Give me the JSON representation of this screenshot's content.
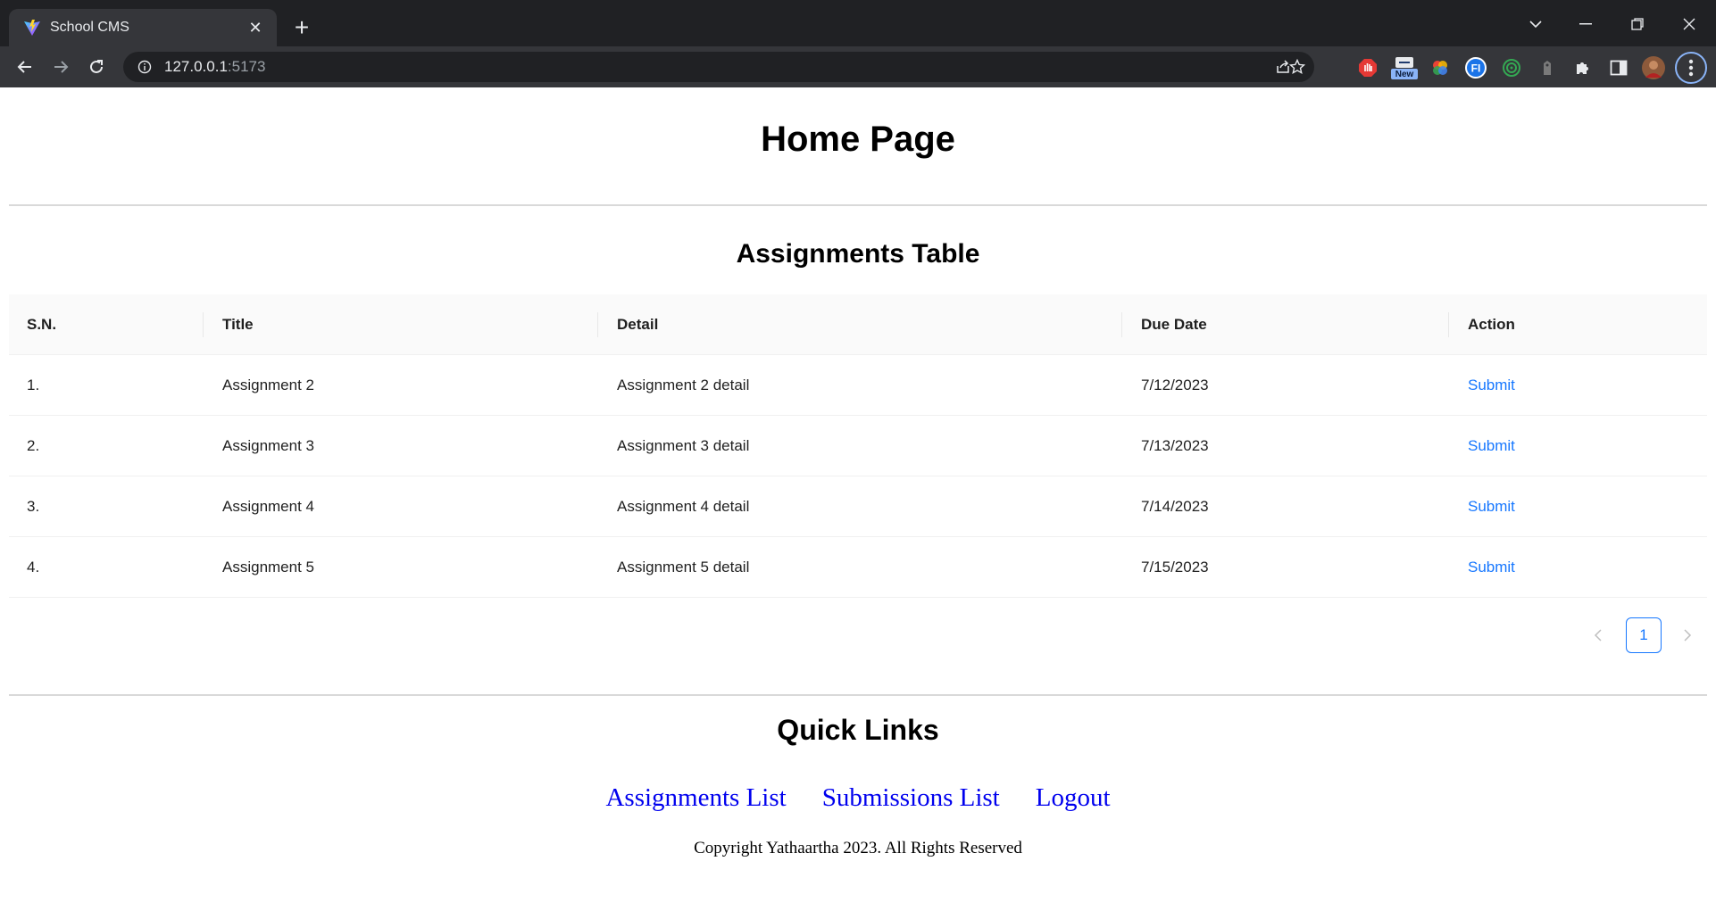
{
  "browser": {
    "tab_title": "School CMS",
    "url_host": "127.0.0.1",
    "url_port": ":5173",
    "extension_badge": "New"
  },
  "page": {
    "title": "Home Page",
    "assignments": {
      "heading": "Assignments Table",
      "columns": [
        "S.N.",
        "Title",
        "Detail",
        "Due Date",
        "Action"
      ],
      "rows": [
        {
          "sn": "1.",
          "title": "Assignment 2",
          "detail": "Assignment 2 detail",
          "due": "7/12/2023",
          "action": "Submit"
        },
        {
          "sn": "2.",
          "title": "Assignment 3",
          "detail": "Assignment 3 detail",
          "due": "7/13/2023",
          "action": "Submit"
        },
        {
          "sn": "3.",
          "title": "Assignment 4",
          "detail": "Assignment 4 detail",
          "due": "7/14/2023",
          "action": "Submit"
        },
        {
          "sn": "4.",
          "title": "Assignment 5",
          "detail": "Assignment 5 detail",
          "due": "7/15/2023",
          "action": "Submit"
        }
      ],
      "current_page": "1"
    },
    "quick_links": {
      "heading": "Quick Links",
      "links": [
        "Assignments List",
        "Submissions List",
        "Logout"
      ]
    },
    "copyright": "Copyright Yathaartha 2023. All Rights Reserved"
  },
  "colors": {
    "link": "#1677ff",
    "quick_link": "#0000ee",
    "chrome_bg": "#202124",
    "toolbar_bg": "#35363a"
  }
}
